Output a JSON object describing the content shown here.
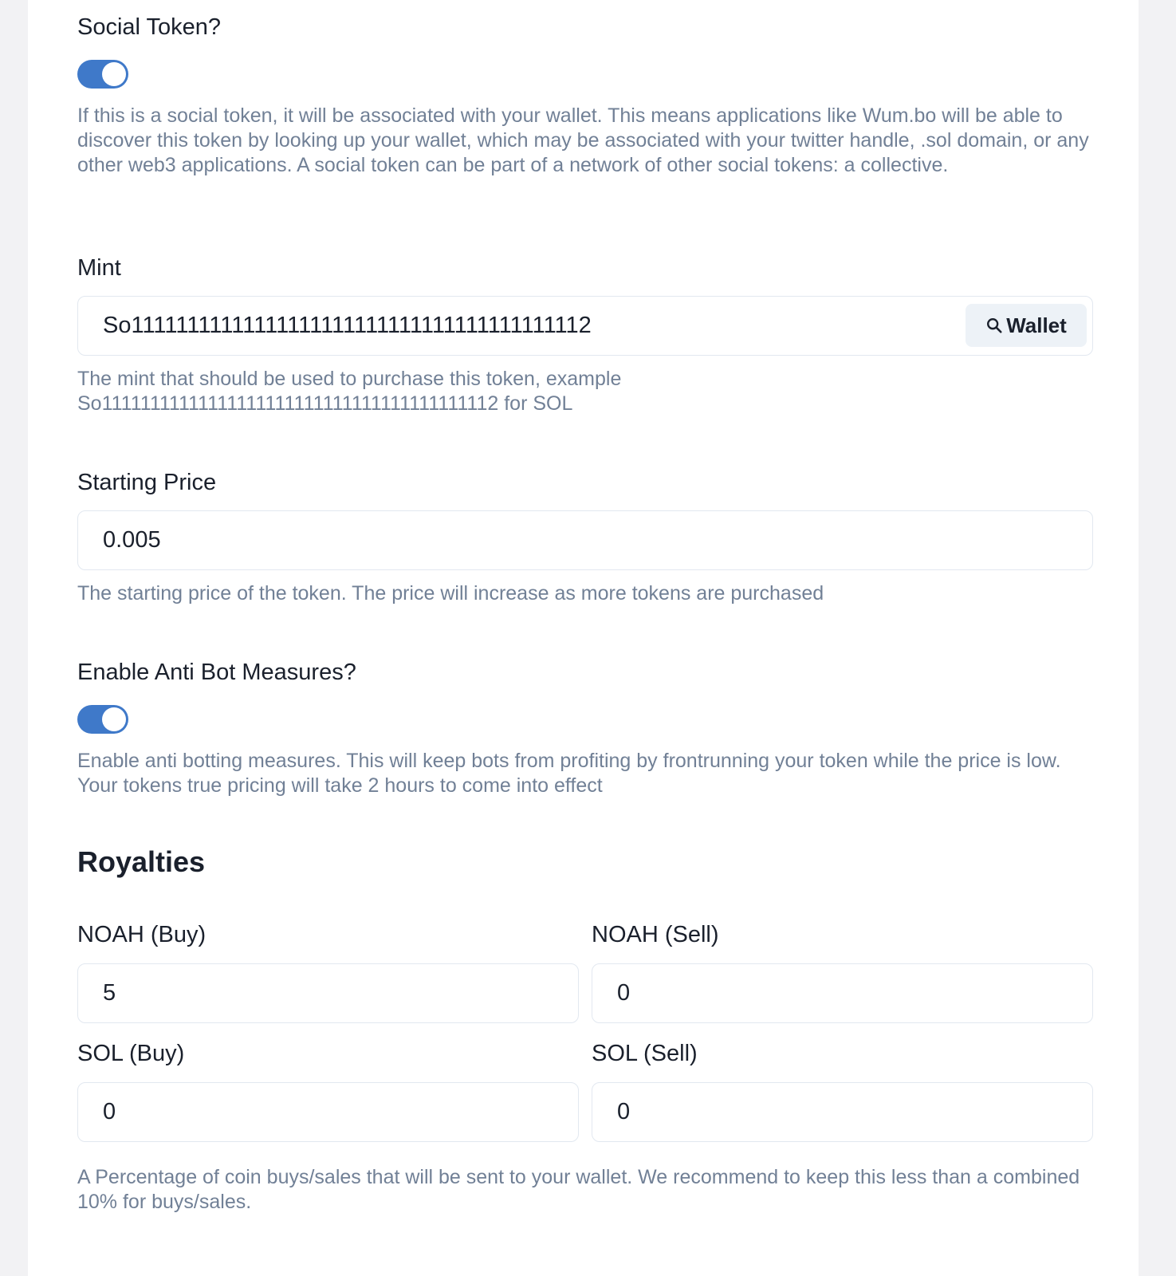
{
  "social_token": {
    "label": "Social Token?",
    "enabled": true,
    "help": "If this is a social token, it will be associated with your wallet. This means applications like Wum.bo will be able to discover this token by looking up your wallet, which may be associated with your twitter handle, .sol domain, or any other web3 applications. A social token can be part of a network of other social tokens: a collective."
  },
  "mint": {
    "label": "Mint",
    "value": "So11111111111111111111111111111111111111112",
    "wallet_button": "Wallet",
    "wallet_icon": "search-icon",
    "help_line1": "The mint that should be used to purchase this token, example",
    "help_line2": "So11111111111111111111111111111111111111112 for SOL"
  },
  "starting_price": {
    "label": "Starting Price",
    "value": "0.005",
    "help": "The starting price of the token. The price will increase as more tokens are purchased"
  },
  "anti_bot": {
    "label": "Enable Anti Bot Measures?",
    "enabled": true,
    "help": "Enable anti botting measures. This will keep bots from profiting by frontrunning your token while the price is low. Your tokens true pricing will take 2 hours to come into effect"
  },
  "royalties": {
    "title": "Royalties",
    "noah_buy_label": "NOAH (Buy)",
    "noah_buy_value": "5",
    "noah_sell_label": "NOAH (Sell)",
    "noah_sell_value": "0",
    "sol_buy_label": "SOL (Buy)",
    "sol_buy_value": "0",
    "sol_sell_label": "SOL (Sell)",
    "sol_sell_value": "0",
    "help": "A Percentage of coin buys/sales that will be sent to your wallet. We recommend to keep this less than a combined 10% for buys/sales."
  },
  "colors": {
    "toggle_on": "#3f79c9",
    "help_text": "#718096",
    "heading_text": "#1a202c",
    "input_border": "#e2e8f0",
    "page_background": "#f2f2f4"
  }
}
